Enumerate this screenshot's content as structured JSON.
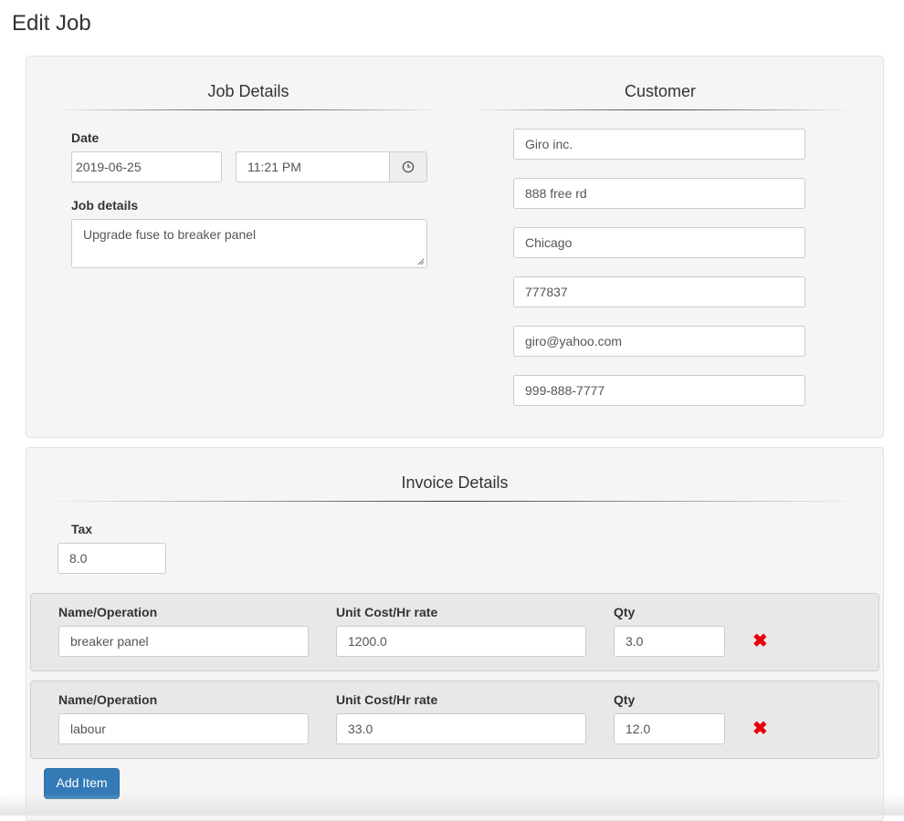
{
  "page": {
    "title": "Edit Job"
  },
  "job_details": {
    "heading": "Job Details",
    "date_label": "Date",
    "date_value": "2019-06-25",
    "time_value": "11:21 PM",
    "details_label": "Job details",
    "details_value": "Upgrade fuse to breaker panel"
  },
  "customer": {
    "heading": "Customer",
    "name": "Giro inc.",
    "address": "888 free rd",
    "city": "Chicago",
    "postal": "777837",
    "email": "giro@yahoo.com",
    "phone": "999-888-7777"
  },
  "invoice": {
    "heading": "Invoice Details",
    "tax_label": "Tax",
    "tax_value": "8.0",
    "col_name": "Name/Operation",
    "col_cost": "Unit Cost/Hr rate",
    "col_qty": "Qty",
    "items": [
      {
        "name": "breaker panel",
        "cost": "1200.0",
        "qty": "3.0"
      },
      {
        "name": "labour",
        "cost": "33.0",
        "qty": "12.0"
      }
    ],
    "add_label": "Add Item"
  },
  "icons": {
    "time": "clock-icon",
    "remove": "remove-x-icon"
  },
  "colors": {
    "primary": "#337ab7",
    "remove": "#e8000b"
  }
}
